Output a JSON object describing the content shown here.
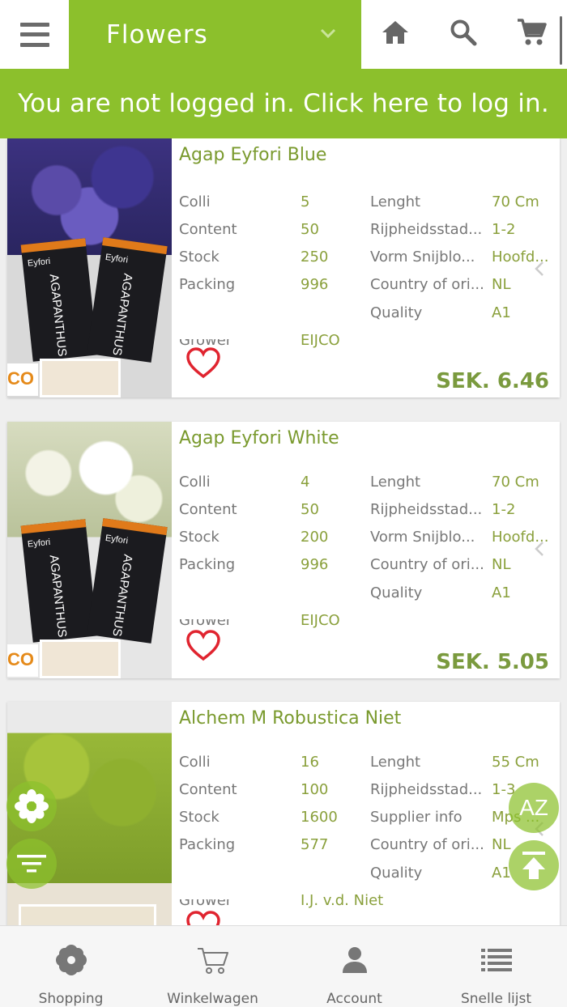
{
  "header": {
    "menu_icon": "hamburger-menu-icon",
    "category": "Flowers",
    "icons": [
      "home-icon",
      "search-icon",
      "cart-icon"
    ]
  },
  "login_banner": {
    "text": "You are not logged in. Click here to log in."
  },
  "products": [
    {
      "title": "Agap Eyfori Blue",
      "left_fields": [
        {
          "label": "Colli",
          "value": "5"
        },
        {
          "label": "Content",
          "value": "50"
        },
        {
          "label": "Stock",
          "value": "250"
        },
        {
          "label": "Packing",
          "value": "996"
        },
        {
          "label": "Grower",
          "value": "EIJCO"
        }
      ],
      "right_fields": [
        {
          "label": "Lenght",
          "value": "70 Cm"
        },
        {
          "label": "Rijpheidsstad...",
          "value": "1-2"
        },
        {
          "label": "Vorm Snijblo...",
          "value": "Hoofd..."
        },
        {
          "label": "Country of ori...",
          "value": "NL"
        },
        {
          "label": "Quality",
          "value": "A1"
        }
      ],
      "price": "SEK. 6.46",
      "photo_text": "AGAPANTHUS",
      "photo_brand": "Eyfori",
      "photo_logo": "CO"
    },
    {
      "title": "Agap Eyfori White",
      "left_fields": [
        {
          "label": "Colli",
          "value": "4"
        },
        {
          "label": "Content",
          "value": "50"
        },
        {
          "label": "Stock",
          "value": "200"
        },
        {
          "label": "Packing",
          "value": "996"
        },
        {
          "label": "Grower",
          "value": "EIJCO"
        }
      ],
      "right_fields": [
        {
          "label": "Lenght",
          "value": "70 Cm"
        },
        {
          "label": "Rijpheidsstad...",
          "value": "1-2"
        },
        {
          "label": "Vorm Snijblo...",
          "value": "Hoofd..."
        },
        {
          "label": "Country of ori...",
          "value": "NL"
        },
        {
          "label": "Quality",
          "value": "A1"
        }
      ],
      "price": "SEK. 5.05",
      "photo_text": "AGAPANTHUS",
      "photo_brand": "Eyfori",
      "photo_logo": "CO"
    },
    {
      "title": "Alchem M Robustica Niet",
      "left_fields": [
        {
          "label": "Colli",
          "value": "16"
        },
        {
          "label": "Content",
          "value": "100"
        },
        {
          "label": "Stock",
          "value": "1600"
        },
        {
          "label": "Packing",
          "value": "577"
        },
        {
          "label": "Grower",
          "value": "I.J. v.d. Niet"
        }
      ],
      "right_fields": [
        {
          "label": "Lenght",
          "value": "55 Cm"
        },
        {
          "label": "Rijpheidsstad...",
          "value": "1-3"
        },
        {
          "label": "Supplier info",
          "value": "Mps ..."
        },
        {
          "label": "Country of ori...",
          "value": "NL"
        },
        {
          "label": "Quality",
          "value": "A1"
        }
      ],
      "price": ""
    }
  ],
  "floating": {
    "sort_label": "AZ"
  },
  "bottom_nav": [
    {
      "label": "Shopping",
      "icon": "flower-icon"
    },
    {
      "label": "Winkelwagen",
      "icon": "cart-outline-icon"
    },
    {
      "label": "Account",
      "icon": "person-icon"
    },
    {
      "label": "Snelle lijst",
      "icon": "list-icon"
    }
  ],
  "colors": {
    "brand_green": "#8cc02c",
    "value_green": "#8aa03c",
    "heart_red": "#e0242f",
    "label_grey": "#777777"
  }
}
